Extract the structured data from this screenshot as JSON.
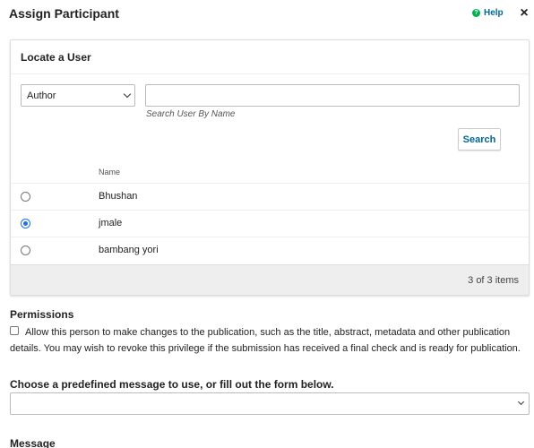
{
  "modal": {
    "title": "Assign Participant",
    "help_label": "Help",
    "close_label": "×"
  },
  "locate": {
    "header": "Locate a User",
    "role_selected": "Author",
    "search_value": "",
    "search_hint": "Search User By Name",
    "search_button": "Search",
    "column_name": "Name",
    "users": [
      {
        "name": "Bhushan",
        "selected": false
      },
      {
        "name": "jmale",
        "selected": true
      },
      {
        "name": "bambang yori",
        "selected": false
      }
    ],
    "count": "3 of 3 items"
  },
  "permissions": {
    "title": "Permissions",
    "checked": false,
    "text": "Allow this person to make changes to the publication, such as the title, abstract, metadata and other publication details. You may wish to revoke this privilege if the submission has received a final check and is ready for publication."
  },
  "predefined": {
    "label": "Choose a predefined message to use, or fill out the form below.",
    "selected": ""
  },
  "message": {
    "label": "Message"
  },
  "colors": {
    "accent": "#006798",
    "help_icon": "#00b24e",
    "radio_selected": "#1a73e8"
  }
}
